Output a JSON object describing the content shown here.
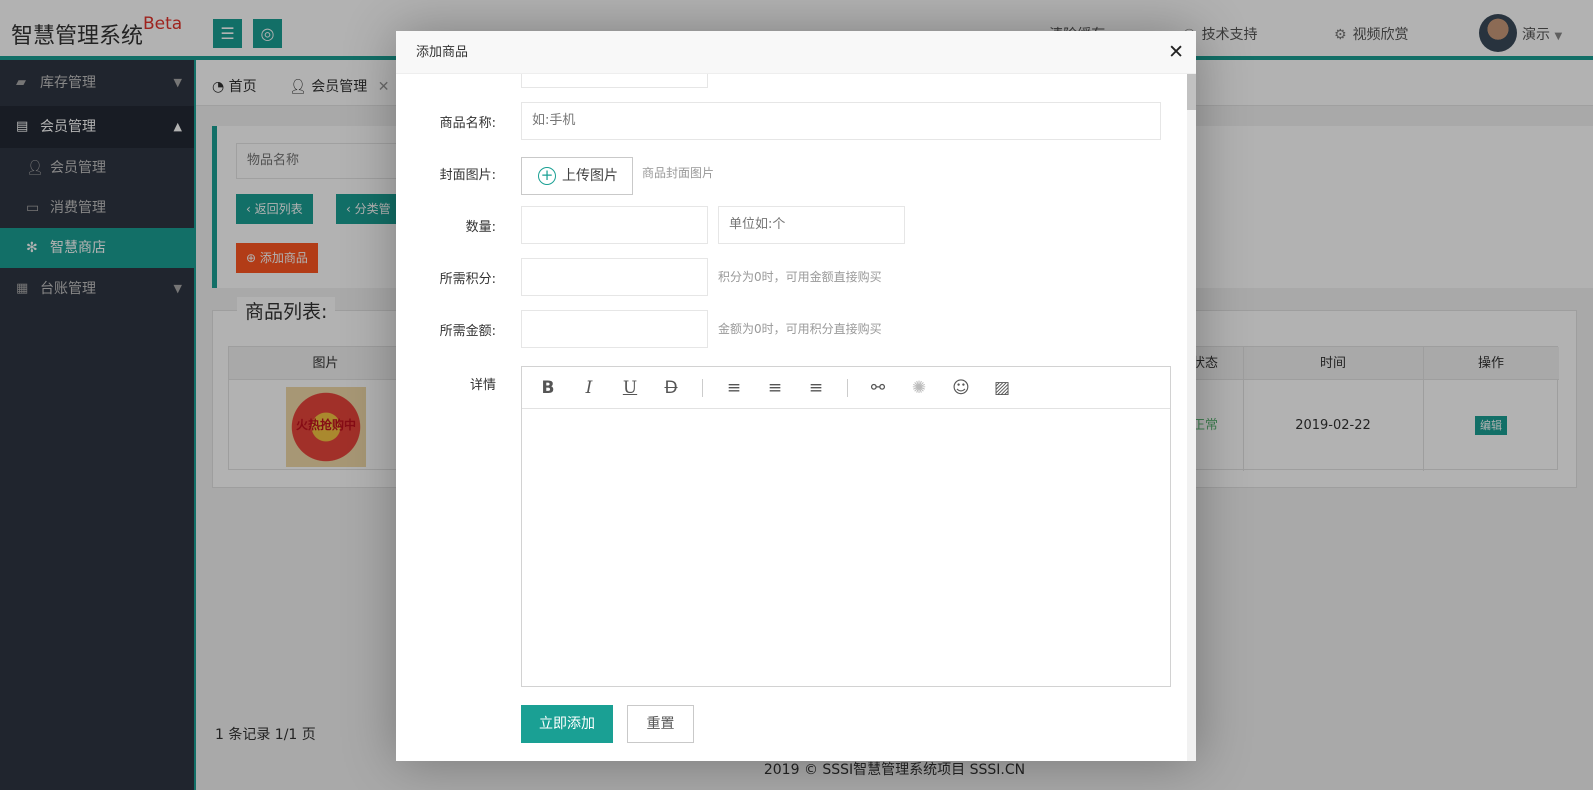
{
  "header": {
    "logo": "智慧管理系统",
    "logo_sup": "Beta",
    "nav": {
      "clear_cache": "清除缓存",
      "tech_support": "技术支持",
      "video": "视频欣赏",
      "user": "演示"
    }
  },
  "sidebar": {
    "inventory": "库存管理",
    "member": "会员管理",
    "sub": {
      "member_manage": "会员管理",
      "consume_manage": "消费管理",
      "smart_shop": "智慧商店"
    },
    "ledger": "台账管理"
  },
  "tabs": {
    "home": "首页",
    "member": "会员管理"
  },
  "search": {
    "placeholder": "物品名称",
    "back_list": "返回列表",
    "category": "分类管",
    "add_product": "添加商品"
  },
  "list": {
    "legend": "商品列表:",
    "columns": {
      "image": "图片",
      "status": "状态",
      "time": "时间",
      "action": "操作"
    },
    "rows": [
      {
        "image_text": "火热抢购中",
        "status": "正常",
        "time": "2019-02-22",
        "action": "编辑"
      }
    ],
    "pager": "1 条记录 1/1 页"
  },
  "footer": {
    "text": "2019 ©  SSSI智慧管理系统项目  SSSI.CN"
  },
  "modal": {
    "title": "添加商品",
    "form": {
      "name_label": "商品名称:",
      "name_placeholder": "如:手机",
      "cover_label": "封面图片:",
      "upload_label": "上传图片",
      "cover_tip": "商品封面图片",
      "qty_label": "数量:",
      "unit_placeholder": "单位如:个",
      "points_label": "所需积分:",
      "points_tip": "积分为0时，可用金额直接购买",
      "amount_label": "所需金额:",
      "amount_tip": "金额为0时，可用积分直接购买",
      "detail_label": "详情",
      "submit": "立即添加",
      "reset": "重置"
    }
  },
  "colors": {
    "accent": "#1aa094",
    "warning": "#ff5722",
    "sidebar_bg": "#2f3542"
  }
}
